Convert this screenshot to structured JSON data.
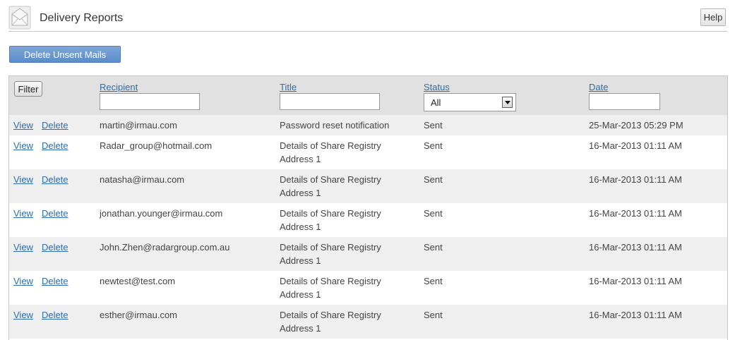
{
  "header": {
    "title": "Delivery Reports",
    "logo_icon": "envelope-icon",
    "help_label": "Help"
  },
  "toolbar": {
    "delete_unsent_label": "Delete Unsent Mails"
  },
  "filter": {
    "button_label": "Filter",
    "columns": {
      "recipient": "Recipient",
      "title": "Title",
      "status": "Status",
      "date": "Date"
    },
    "recipient_value": "",
    "title_value": "",
    "status_selected": "All",
    "date_value": ""
  },
  "actions": {
    "view": "View",
    "delete": "Delete"
  },
  "rows": [
    {
      "recipient": "martin@irmau.com",
      "title": "Password reset notification",
      "status": "Sent",
      "date": "25-Mar-2013 05:29 PM"
    },
    {
      "recipient": "Radar_group@hotmail.com",
      "title": "Details of Share Registry Address 1",
      "status": "Sent",
      "date": "16-Mar-2013 01:11 AM"
    },
    {
      "recipient": "natasha@irmau.com",
      "title": "Details of Share Registry Address 1",
      "status": "Sent",
      "date": "16-Mar-2013 01:11 AM"
    },
    {
      "recipient": "jonathan.younger@irmau.com",
      "title": "Details of Share Registry Address 1",
      "status": "Sent",
      "date": "16-Mar-2013 01:11 AM"
    },
    {
      "recipient": "John.Zhen@radargroup.com.au",
      "title": "Details of Share Registry Address 1",
      "status": "Sent",
      "date": "16-Mar-2013 01:11 AM"
    },
    {
      "recipient": "newtest@test.com",
      "title": "Details of Share Registry Address 1",
      "status": "Sent",
      "date": "16-Mar-2013 01:11 AM"
    },
    {
      "recipient": "esther@irmau.com",
      "title": "Details of Share Registry Address 1",
      "status": "Sent",
      "date": "16-Mar-2013 01:11 AM"
    }
  ]
}
